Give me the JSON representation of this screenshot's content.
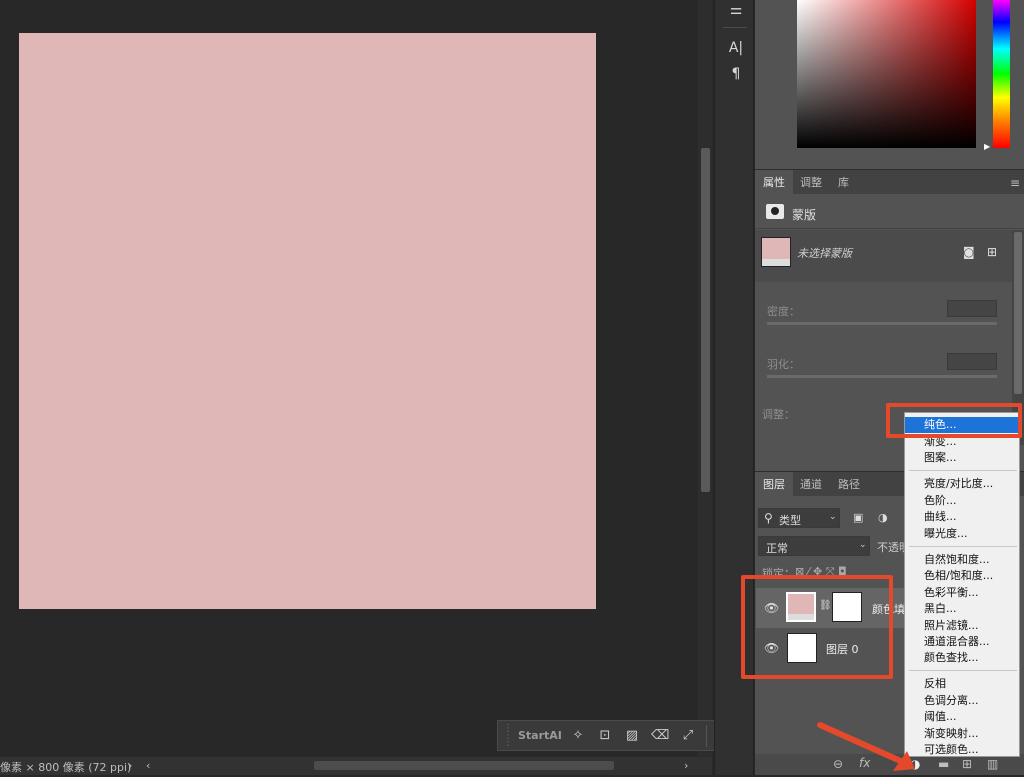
{
  "status": {
    "doc_info": "像素 × 800 像素 (72 ppi)",
    "arrow_right": "›",
    "arrow_left": "‹",
    "arrow_right2": "›"
  },
  "startai": {
    "label": "StartAI",
    "icons": [
      "magic-wand-icon",
      "image-edit-icon",
      "stripes-icon",
      "eraser-icon",
      "expand-icon",
      "settings-icon"
    ]
  },
  "toolstrip": {
    "tools": [
      "sliders-icon",
      "character-icon",
      "paragraph-icon"
    ],
    "glyphs": [
      "⚌",
      "A|",
      "¶"
    ]
  },
  "properties": {
    "tabs": [
      "属性",
      "调整",
      "库"
    ],
    "section_title": "蒙版",
    "mask_label": "未选择蒙版",
    "density_label": "密度：",
    "feather_label": "羽化：",
    "adjust_label": "调整："
  },
  "layers": {
    "tabs": [
      "图层",
      "通道",
      "路径"
    ],
    "filter_label": "类型",
    "blend_mode": "正常",
    "opacity_label": "不透明",
    "lock_label": "锁定：",
    "rows": [
      {
        "name": "颜色填",
        "visible": true
      },
      {
        "name": "图层 0",
        "visible": true
      }
    ]
  },
  "bottom_bar": {
    "icons": [
      "link-icon",
      "fx-icon",
      "mask-icon",
      "adjustment-icon",
      "group-icon",
      "new-layer-icon",
      "trash-icon"
    ],
    "fx_label": "fx"
  },
  "adjust_menu": {
    "groups": [
      [
        "纯色...",
        "渐变...",
        "图案..."
      ],
      [
        "亮度/对比度...",
        "色阶...",
        "曲线...",
        "曝光度..."
      ],
      [
        "自然饱和度...",
        "色相/饱和度...",
        "色彩平衡...",
        "黑白...",
        "照片滤镜...",
        "通道混合器...",
        "颜色查找..."
      ],
      [
        "反相",
        "色调分离...",
        "阈值...",
        "渐变映射...",
        "可选颜色..."
      ]
    ],
    "highlighted": "纯色..."
  },
  "colors": {
    "canvas": "#dfb7b6",
    "accent": "#e5492b",
    "highlight": "#1d73d8"
  }
}
